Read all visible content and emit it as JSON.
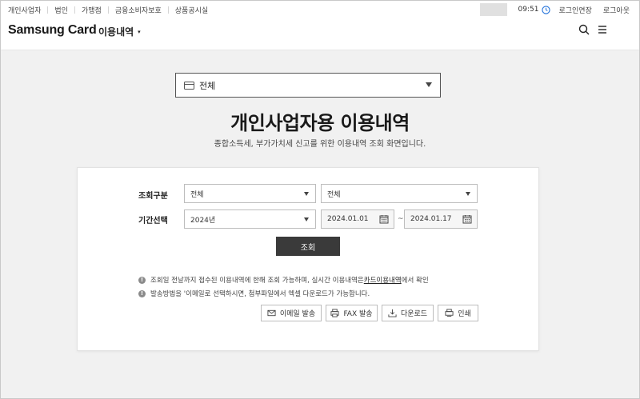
{
  "topbar": {
    "links": [
      "개인사업자",
      "법인",
      "가맹점",
      "금융소비자보호",
      "상품공시실"
    ],
    "timer": "09:51",
    "extend_login": "로그인연장",
    "logout": "로그아웃"
  },
  "header": {
    "logo": "Samsung Card",
    "menu_title": "이용내역",
    "menu_caret": "▾"
  },
  "category_select": {
    "value": "전체"
  },
  "page": {
    "title": "개인사업자용 이용내역",
    "subtitle": "종합소득세, 부가가치세 신고를 위한 이용내역 조회 화면입니다."
  },
  "form": {
    "type_label": "조회구분",
    "type_select_1": "전체",
    "type_select_2": "전체",
    "period_label": "기간선택",
    "year_select": "2024년",
    "date_from": "2024.01.01",
    "tilde": "~",
    "date_to": "2024.01.17",
    "search_button": "조회"
  },
  "notices": [
    {
      "before": "조회일 전날까지 접수된 이용내역에 한해 조회 가능하며, 실시간 이용내역은 ",
      "link": "카드이용내역",
      "after": "에서 확인"
    },
    {
      "before": "발송방법을 '이메일로 선택하시면, 첨부파일에서 엑셀 다운로드가 가능합니다.",
      "link": "",
      "after": ""
    }
  ],
  "actions": {
    "email": "이메일 발송",
    "fax": "FAX 발송",
    "download": "다운로드",
    "print": "인쇄"
  },
  "colors": {
    "primary_button": "#3a3a3a",
    "timer_accent": "#1e6fd9",
    "background": "#f1f1f1"
  }
}
